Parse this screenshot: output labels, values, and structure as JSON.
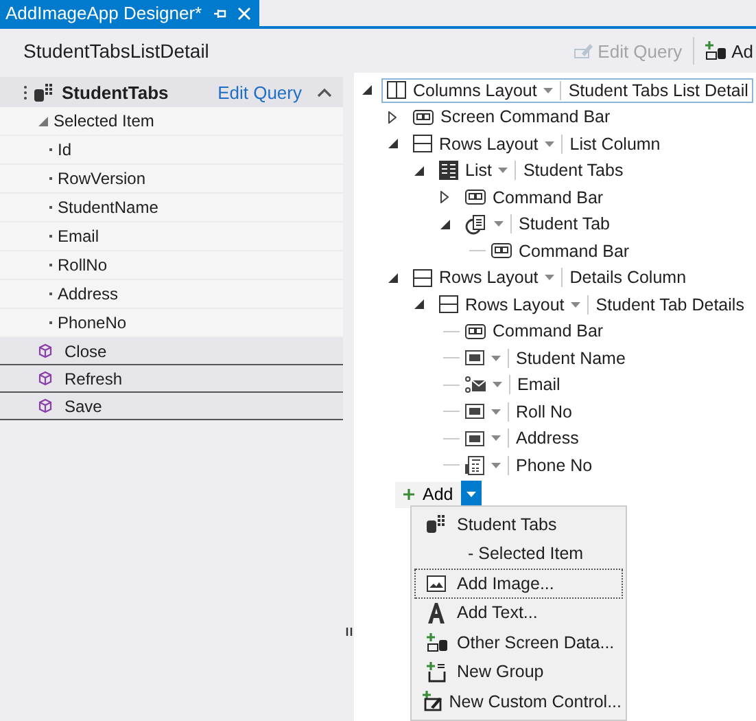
{
  "tab": {
    "title": "AddImageApp Designer*",
    "selected": true
  },
  "toolbar": {
    "screen_name": "StudentTabsListDetail",
    "buttons": [
      {
        "label": "Edit Query",
        "kind": "query",
        "disabled": true
      },
      {
        "label": "Ad",
        "kind": "adddata",
        "disabled": false
      }
    ]
  },
  "data_panel": {
    "collection": "StudentTabs",
    "edit_link": "Edit Query",
    "expanded": true,
    "group": {
      "label": "Selected Item",
      "expanded": true,
      "fields": [
        "Id",
        "RowVersion",
        "StudentName",
        "Email",
        "RollNo",
        "Address",
        "PhoneNo"
      ]
    },
    "methods": [
      "Close",
      "Refresh",
      "Save"
    ]
  },
  "tree": {
    "nodes": [
      {
        "kind": "columns",
        "label": "Columns Layout",
        "name": "Student Tabs List Detail",
        "expanded": true,
        "selected": true,
        "children": [
          {
            "kind": "commandbar",
            "label": "Screen Command Bar",
            "expanded": false,
            "selected": false
          },
          {
            "kind": "rows",
            "label": "Rows Layout",
            "name": "List Column",
            "expanded": true,
            "selected": false,
            "children": [
              {
                "kind": "list",
                "label": "List",
                "name": "Student Tabs",
                "expanded": true,
                "selected": false,
                "children": [
                  {
                    "kind": "commandbar",
                    "label": "Command Bar",
                    "expanded": false,
                    "selected": false
                  },
                  {
                    "kind": "item",
                    "name": "Student Tab",
                    "expanded": true,
                    "selected": false,
                    "children": [
                      {
                        "kind": "commandbar",
                        "label": "Command Bar",
                        "selected": false
                      }
                    ]
                  }
                ]
              }
            ]
          },
          {
            "kind": "rows",
            "label": "Rows Layout",
            "name": "Details Column",
            "expanded": true,
            "selected": false,
            "children": [
              {
                "kind": "rows",
                "label": "Rows Layout",
                "name": "Student Tab Details",
                "expanded": true,
                "selected": false,
                "children": [
                  {
                    "kind": "commandbar",
                    "label": "Command Bar",
                    "selected": false
                  },
                  {
                    "kind": "textbox",
                    "name": "Student Name",
                    "selected": false
                  },
                  {
                    "kind": "email",
                    "name": "Email",
                    "selected": false
                  },
                  {
                    "kind": "textbox",
                    "name": "Roll No",
                    "selected": false
                  },
                  {
                    "kind": "textbox",
                    "name": "Address",
                    "selected": false
                  },
                  {
                    "kind": "phone",
                    "name": "Phone No",
                    "selected": false
                  }
                ]
              }
            ]
          }
        ]
      }
    ],
    "add_button": "Add"
  },
  "menu": {
    "items": [
      {
        "kind": "data",
        "label": "Student Tabs",
        "selected": false
      },
      {
        "kind": "sub",
        "label": "- Selected Item",
        "selected": false
      },
      {
        "kind": "image",
        "label": "Add Image...",
        "selected": true
      },
      {
        "kind": "text",
        "label": "Add Text...",
        "selected": false
      },
      {
        "kind": "otherdata",
        "label": "Other Screen Data...",
        "selected": false
      },
      {
        "kind": "group",
        "label": "New Group",
        "selected": false
      },
      {
        "kind": "custom",
        "label": "New Custom Control...",
        "selected": false
      }
    ]
  }
}
